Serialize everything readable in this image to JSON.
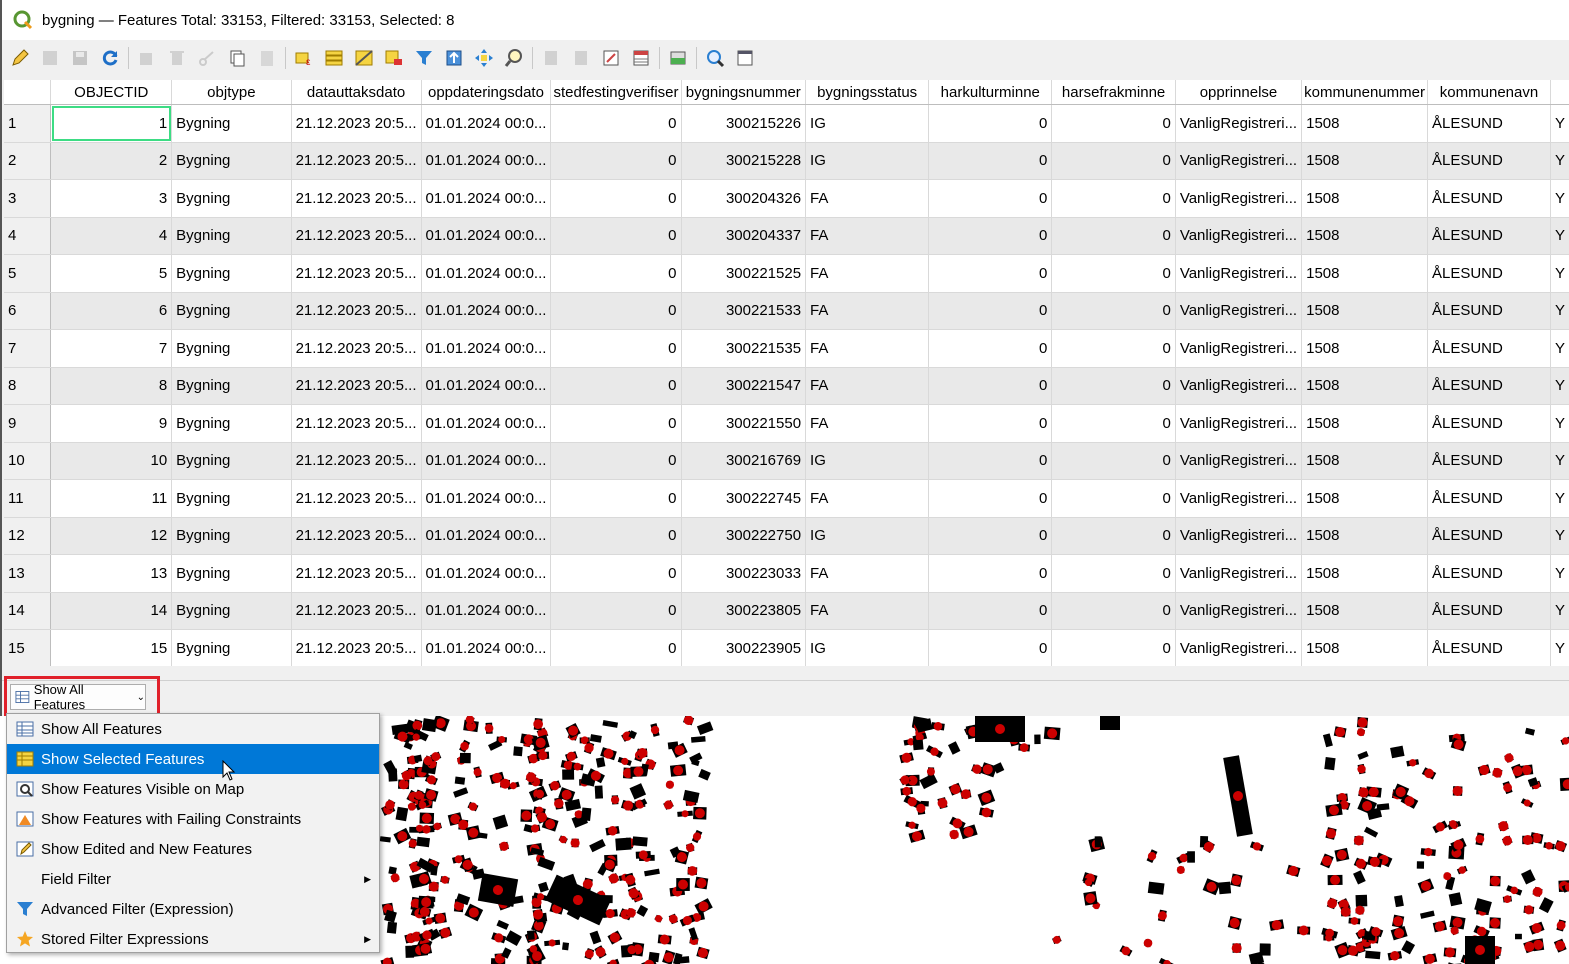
{
  "window": {
    "title": "bygning — Features Total: 33153, Filtered: 33153, Selected: 8"
  },
  "toolbar": {
    "icons": [
      "pencil-icon",
      "edit-icon",
      "save-icon",
      "reload-icon",
      "add-feature-icon",
      "delete-icon",
      "cut-icon",
      "copy-icon",
      "paste-icon",
      "expression-select-icon",
      "select-all-icon",
      "invert-selection-icon",
      "deselect-icon",
      "filter-icon",
      "move-to-top-icon",
      "pan-to-selection-icon",
      "zoom-to-selection-icon",
      "new-field-icon",
      "delete-field-icon",
      "field-calculator-icon",
      "conditional-format-icon",
      "dock-icon",
      "actions-icon",
      "form-view-icon"
    ]
  },
  "table": {
    "columns": [
      "OBJECTID",
      "objtype",
      "datauttaksdato",
      "oppdateringsdato",
      "stedfestingverifiser",
      "bygningsnummer",
      "bygningsstatus",
      "harkulturminne",
      "harsefrakminne",
      "opprinnelse",
      "kommunenummer",
      "kommunenavn",
      ""
    ],
    "rows": [
      [
        "1",
        "1",
        "Bygning",
        "21.12.2023 20:5...",
        "01.01.2024 00:0...",
        "0",
        "300215226",
        "IG",
        "0",
        "0",
        "VanligRegistreri...",
        "1508",
        "ÅLESUND",
        "Y"
      ],
      [
        "2",
        "2",
        "Bygning",
        "21.12.2023 20:5...",
        "01.01.2024 00:0...",
        "0",
        "300215228",
        "IG",
        "0",
        "0",
        "VanligRegistreri...",
        "1508",
        "ÅLESUND",
        "Y"
      ],
      [
        "3",
        "3",
        "Bygning",
        "21.12.2023 20:5...",
        "01.01.2024 00:0...",
        "0",
        "300204326",
        "FA",
        "0",
        "0",
        "VanligRegistreri...",
        "1508",
        "ÅLESUND",
        "Y"
      ],
      [
        "4",
        "4",
        "Bygning",
        "21.12.2023 20:5...",
        "01.01.2024 00:0...",
        "0",
        "300204337",
        "FA",
        "0",
        "0",
        "VanligRegistreri...",
        "1508",
        "ÅLESUND",
        "Y"
      ],
      [
        "5",
        "5",
        "Bygning",
        "21.12.2023 20:5...",
        "01.01.2024 00:0...",
        "0",
        "300221525",
        "FA",
        "0",
        "0",
        "VanligRegistreri...",
        "1508",
        "ÅLESUND",
        "Y"
      ],
      [
        "6",
        "6",
        "Bygning",
        "21.12.2023 20:5...",
        "01.01.2024 00:0...",
        "0",
        "300221533",
        "FA",
        "0",
        "0",
        "VanligRegistreri...",
        "1508",
        "ÅLESUND",
        "Y"
      ],
      [
        "7",
        "7",
        "Bygning",
        "21.12.2023 20:5...",
        "01.01.2024 00:0...",
        "0",
        "300221535",
        "FA",
        "0",
        "0",
        "VanligRegistreri...",
        "1508",
        "ÅLESUND",
        "Y"
      ],
      [
        "8",
        "8",
        "Bygning",
        "21.12.2023 20:5...",
        "01.01.2024 00:0...",
        "0",
        "300221547",
        "FA",
        "0",
        "0",
        "VanligRegistreri...",
        "1508",
        "ÅLESUND",
        "Y"
      ],
      [
        "9",
        "9",
        "Bygning",
        "21.12.2023 20:5...",
        "01.01.2024 00:0...",
        "0",
        "300221550",
        "FA",
        "0",
        "0",
        "VanligRegistreri...",
        "1508",
        "ÅLESUND",
        "Y"
      ],
      [
        "10",
        "10",
        "Bygning",
        "21.12.2023 20:5...",
        "01.01.2024 00:0...",
        "0",
        "300216769",
        "IG",
        "0",
        "0",
        "VanligRegistreri...",
        "1508",
        "ÅLESUND",
        "Y"
      ],
      [
        "11",
        "11",
        "Bygning",
        "21.12.2023 20:5...",
        "01.01.2024 00:0...",
        "0",
        "300222745",
        "FA",
        "0",
        "0",
        "VanligRegistreri...",
        "1508",
        "ÅLESUND",
        "Y"
      ],
      [
        "12",
        "12",
        "Bygning",
        "21.12.2023 20:5...",
        "01.01.2024 00:0...",
        "0",
        "300222750",
        "IG",
        "0",
        "0",
        "VanligRegistreri...",
        "1508",
        "ÅLESUND",
        "Y"
      ],
      [
        "13",
        "13",
        "Bygning",
        "21.12.2023 20:5...",
        "01.01.2024 00:0...",
        "0",
        "300223033",
        "FA",
        "0",
        "0",
        "VanligRegistreri...",
        "1508",
        "ÅLESUND",
        "Y"
      ],
      [
        "14",
        "14",
        "Bygning",
        "21.12.2023 20:5...",
        "01.01.2024 00:0...",
        "0",
        "300223805",
        "FA",
        "0",
        "0",
        "VanligRegistreri...",
        "1508",
        "ÅLESUND",
        "Y"
      ],
      [
        "15",
        "15",
        "Bygning",
        "21.12.2023 20:5...",
        "01.01.2024 00:0...",
        "0",
        "300223905",
        "IG",
        "0",
        "0",
        "VanligRegistreri...",
        "1508",
        "ÅLESUND",
        "Y"
      ]
    ]
  },
  "filter_button": {
    "label": "Show All Features"
  },
  "menu": {
    "items": [
      {
        "label": "Show All Features",
        "icon": "table-icon",
        "submenu": false,
        "highlighted": false
      },
      {
        "label": "Show Selected Features",
        "icon": "selected-table-icon",
        "submenu": false,
        "highlighted": true
      },
      {
        "label": "Show Features Visible on Map",
        "icon": "map-visible-icon",
        "submenu": false,
        "highlighted": false
      },
      {
        "label": "Show Features with Failing Constraints",
        "icon": "constraint-icon",
        "submenu": false,
        "highlighted": false
      },
      {
        "label": "Show Edited and New Features",
        "icon": "edited-icon",
        "submenu": false,
        "highlighted": false
      },
      {
        "label": "Field Filter",
        "icon": "",
        "submenu": true,
        "highlighted": false
      },
      {
        "label": "Advanced Filter (Expression)",
        "icon": "funnel-icon",
        "submenu": false,
        "highlighted": false
      },
      {
        "label": "Stored Filter Expressions",
        "icon": "star-icon",
        "submenu": true,
        "highlighted": false
      }
    ]
  },
  "colors": {
    "highlight": "#0078d7",
    "annotation": "#e0202a",
    "building_fill": "#000000",
    "point_fill": "#cc0000"
  }
}
